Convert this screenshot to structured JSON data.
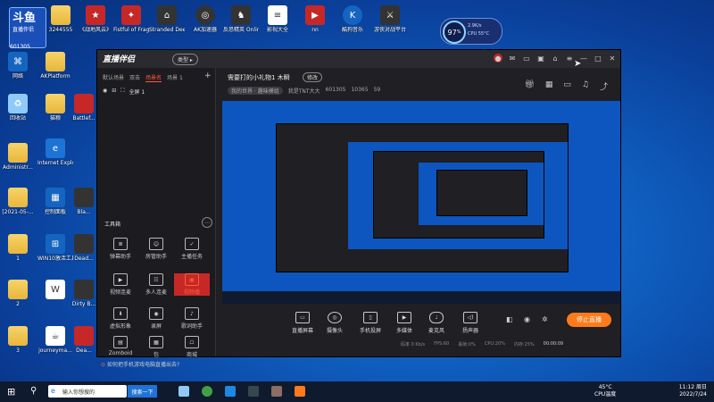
{
  "desktop": {
    "live_logo": {
      "brand": "斗鱼",
      "sub": "直播伴侣",
      "number": "601305"
    },
    "icons_top": [
      {
        "label": "3244555",
        "icon": "folder-icon"
      },
      {
        "label": "《战地风云》",
        "icon": "game-icon"
      },
      {
        "label": "Fistful of Frags",
        "icon": "game-icon"
      },
      {
        "label": "Stranded Deep",
        "icon": "game-icon"
      },
      {
        "label": "AK加速器",
        "icon": "accelerator-icon"
      },
      {
        "label": "反恐精英 Online",
        "icon": "game-icon"
      },
      {
        "label": "影视大全",
        "icon": "document-icon"
      },
      {
        "label": "nn",
        "icon": "video-icon"
      },
      {
        "label": "酷狗音乐",
        "icon": "music-icon"
      },
      {
        "label": "游侠对战平台",
        "icon": "game-icon"
      }
    ],
    "icons_left": [
      {
        "label": "网络",
        "icon": "network-icon"
      },
      {
        "label": "回收站",
        "icon": "recycle-bin-icon"
      },
      {
        "label": "Administr...",
        "icon": "folder-icon"
      },
      {
        "label": "[2021-05-...",
        "icon": "folder-icon"
      },
      {
        "label": "1",
        "icon": "folder-icon"
      },
      {
        "label": "2",
        "icon": "folder-icon"
      },
      {
        "label": "3",
        "icon": "folder-icon"
      }
    ],
    "icons_col2": [
      {
        "label": "AKPlatform",
        "icon": "folder-icon"
      },
      {
        "label": "猫粮",
        "icon": "folder-icon"
      },
      {
        "label": "Internet Explorer",
        "icon": "ie-icon"
      },
      {
        "label": "控制面板",
        "icon": "control-panel-icon"
      },
      {
        "label": "WIN10激活工具",
        "icon": "tool-icon"
      },
      {
        "label": "",
        "icon": "document-icon"
      },
      {
        "label": "journeyma...",
        "icon": "java-icon"
      }
    ],
    "icons_col3": [
      {
        "label": "Battlef...",
        "icon": "game-icon"
      },
      {
        "label": "Bla...",
        "icon": "game-icon"
      },
      {
        "label": "Dead...",
        "icon": "game-icon"
      },
      {
        "label": "Dirty B...",
        "icon": "game-icon"
      },
      {
        "label": "Dea...",
        "icon": "game-icon"
      }
    ]
  },
  "perf_widget": {
    "value": "97",
    "unit": "%",
    "line1": "2.9K/s",
    "line2": "CPU 55°C"
  },
  "app": {
    "brand": "直播伴侣",
    "brand_pill": "类型 ▸",
    "scene_tabs": [
      "默认场景",
      "双击",
      "场景名",
      "场景 1"
    ],
    "active_scene_tab": "场景名",
    "scene_item": "全屏 1",
    "tools_title": "工具箱",
    "tools": [
      {
        "label": "弹幕助手",
        "icon": "danmu-icon"
      },
      {
        "label": "房管助手",
        "icon": "admin-icon"
      },
      {
        "label": "主播任务",
        "icon": "task-icon"
      },
      {
        "label": "视频连麦",
        "icon": "video-link-icon"
      },
      {
        "label": "多人连麦",
        "icon": "multi-link-icon"
      },
      {
        "label": "视频播",
        "icon": "video-play-icon",
        "active": true
      },
      {
        "label": "虚拟形象",
        "icon": "avatar-icon"
      },
      {
        "label": "录屏",
        "icon": "record-icon"
      },
      {
        "label": "歌词助手",
        "icon": "lyrics-icon"
      },
      {
        "label": "Zomboid",
        "icon": "game-icon"
      },
      {
        "label": "包",
        "icon": "bag-icon"
      },
      {
        "label": "商城",
        "icon": "shop-icon"
      }
    ],
    "bottom_tip": "如何把手机游戏电脑直播出去?",
    "room_title": "需要打的小礼物1 木瞬",
    "room_edit": "修改",
    "room_meta": {
      "category": "我的世界 · 趣味模组",
      "host": "我是TNT大大",
      "room_id": "601305",
      "followers": "10365",
      "viewers": "59"
    },
    "top_tool_icons": [
      "gift-icon",
      "layout-icon",
      "screen-icon",
      "bell-icon",
      "share-icon"
    ],
    "bottom_bar": [
      {
        "label": "直播屏幕",
        "icon": "screen-share-icon"
      },
      {
        "label": "摄像头",
        "icon": "camera-icon"
      },
      {
        "label": "手机投屏",
        "icon": "phone-cast-icon"
      },
      {
        "label": "多媒体",
        "icon": "media-icon"
      },
      {
        "label": "麦克风",
        "icon": "mic-icon"
      },
      {
        "label": "扬声器",
        "icon": "speaker-icon"
      }
    ],
    "stop_button": "停止直播",
    "status": [
      {
        "label": "码率 0 Kb/s"
      },
      {
        "label": "FPS:60"
      },
      {
        "label": "丢帧:0%"
      },
      {
        "label": "CPU:20%"
      },
      {
        "label": "内存:25%"
      }
    ],
    "live_time": "00:00:09"
  },
  "taskbar": {
    "search_placeholder": "输入你想搜的",
    "search_button": "搜索一下",
    "temp": "45°C",
    "temp_label": "CPU温度",
    "time": "11:12 周日",
    "date": "2022/7/24"
  },
  "colors": {
    "accent": "#ff7a1a",
    "active_tab": "#ff5a3c",
    "desktop_blue": "#0f5fc0"
  }
}
